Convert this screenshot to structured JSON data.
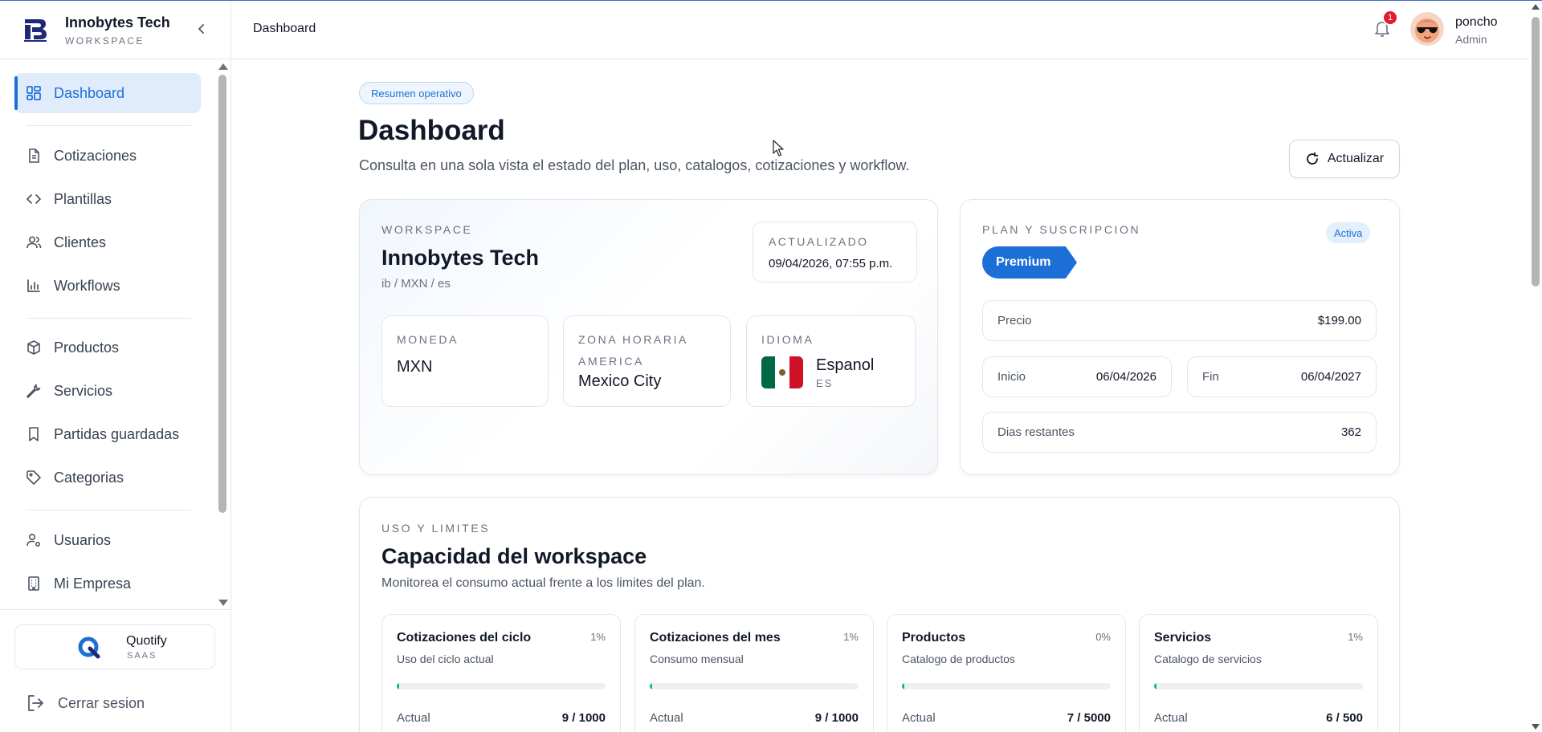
{
  "brand": {
    "name": "Innobytes Tech",
    "subtitle": "WORKSPACE",
    "accent": "#1d6fd8"
  },
  "sidebar": {
    "items": [
      {
        "label": "Dashboard",
        "icon": "dashboard-grid-icon",
        "active": true
      },
      {
        "label": "Cotizaciones",
        "icon": "document-icon"
      },
      {
        "label": "Plantillas",
        "icon": "code-icon"
      },
      {
        "label": "Clientes",
        "icon": "users-icon"
      },
      {
        "label": "Workflows",
        "icon": "bar-chart-icon"
      },
      {
        "label": "Productos",
        "icon": "box-icon"
      },
      {
        "label": "Servicios",
        "icon": "wrench-icon"
      },
      {
        "label": "Partidas guardadas",
        "icon": "bookmark-icon"
      },
      {
        "label": "Categorias",
        "icon": "tag-icon"
      },
      {
        "label": "Usuarios",
        "icon": "user-settings-icon"
      },
      {
        "label": "Mi Empresa",
        "icon": "building-icon"
      }
    ],
    "app": {
      "name": "Quotify",
      "subtitle": "SAAS"
    },
    "logout_label": "Cerrar sesion"
  },
  "header": {
    "breadcrumb": "Dashboard",
    "notification_count": "1",
    "user": {
      "name": "poncho",
      "role": "Admin"
    }
  },
  "main": {
    "pill": "Resumen operativo",
    "title": "Dashboard",
    "description": "Consulta en una sola vista el estado del plan, uso, catalogos, cotizaciones y workflow.",
    "refresh_label": "Actualizar"
  },
  "workspace": {
    "eyebrow": "WORKSPACE",
    "name": "Innobytes Tech",
    "meta": "ib / MXN / es",
    "updated_label": "ACTUALIZADO",
    "updated_value": "09/04/2026, 07:55 p.m.",
    "currency_label": "MONEDA",
    "currency_value": "MXN",
    "timezone_label": "ZONA HORARIA",
    "timezone_region": "AMERICA",
    "timezone_city": "Mexico City",
    "language_label": "IDIOMA",
    "language_value": "Espanol",
    "language_code": "ES"
  },
  "plan": {
    "eyebrow": "PLAN Y SUSCRIPCION",
    "status": "Activa",
    "tier": "Premium",
    "price_label": "Precio",
    "price_value": "$199.00",
    "start_label": "Inicio",
    "start_value": "06/04/2026",
    "end_label": "Fin",
    "end_value": "06/04/2027",
    "days_label": "Dias restantes",
    "days_value": "362"
  },
  "usage": {
    "eyebrow": "USO Y LIMITES",
    "title": "Capacidad del workspace",
    "description": "Monitorea el consumo actual frente a los limites del plan.",
    "bar_color": "#12b886",
    "metrics": [
      {
        "title": "Cotizaciones del ciclo",
        "percent": "1%",
        "subtitle": "Uso del ciclo actual",
        "label": "Actual",
        "value": "9 / 1000",
        "fraction": 0.009
      },
      {
        "title": "Cotizaciones del mes",
        "percent": "1%",
        "subtitle": "Consumo mensual",
        "label": "Actual",
        "value": "9 / 1000",
        "fraction": 0.009
      },
      {
        "title": "Productos",
        "percent": "0%",
        "subtitle": "Catalogo de productos",
        "label": "Actual",
        "value": "7 / 5000",
        "fraction": 0.0014
      },
      {
        "title": "Servicios",
        "percent": "1%",
        "subtitle": "Catalogo de servicios",
        "label": "Actual",
        "value": "6 / 500",
        "fraction": 0.012
      }
    ]
  }
}
